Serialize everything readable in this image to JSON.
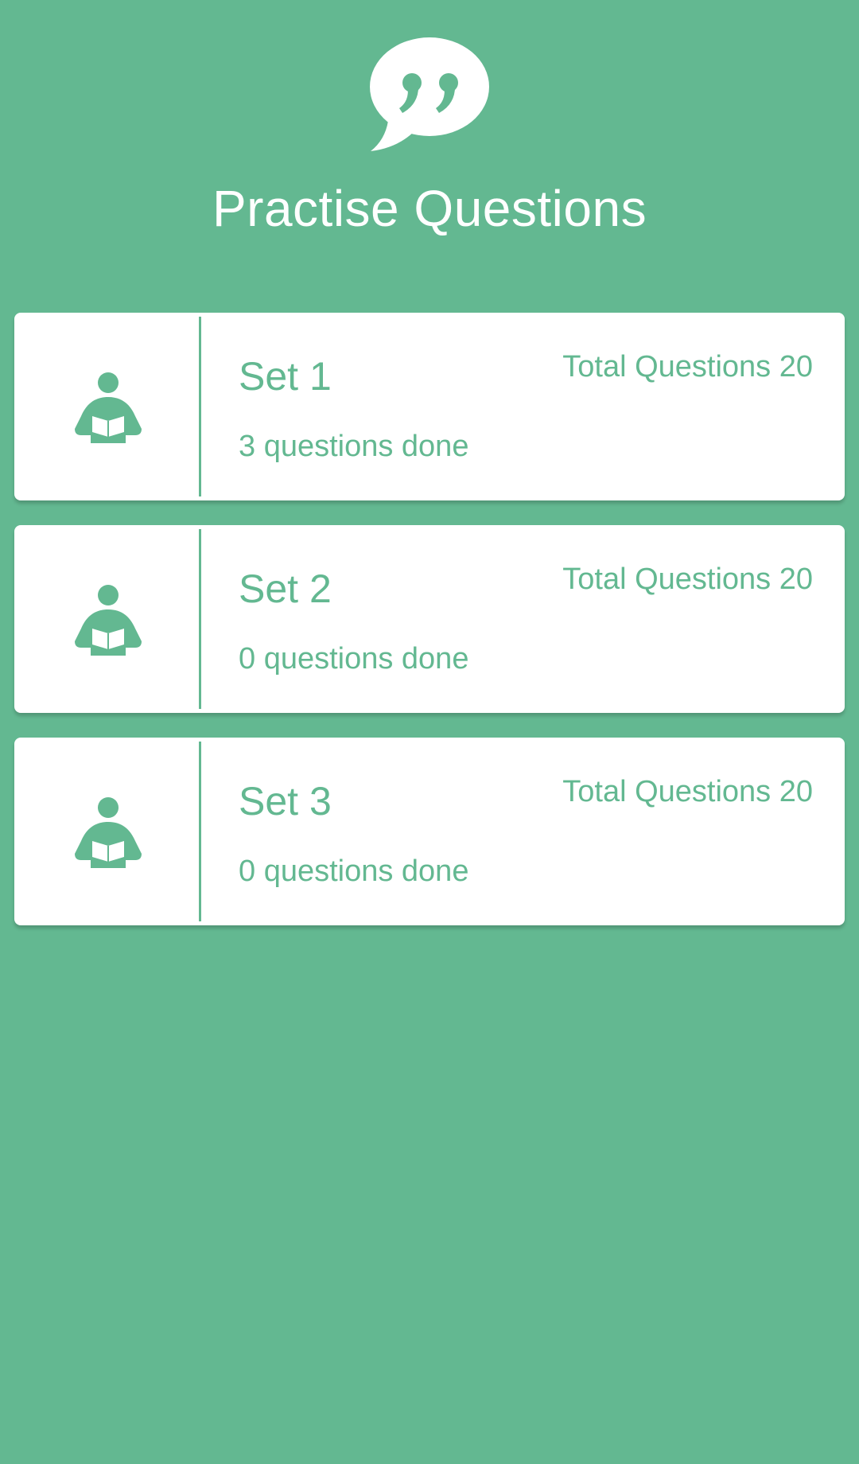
{
  "header": {
    "logo_icon": "quote-speech-bubble-icon",
    "title": "Practise Questions"
  },
  "colors": {
    "background": "#63b891",
    "card": "#ffffff",
    "accent": "#63b891"
  },
  "sets": [
    {
      "icon": "person-reading-book-icon",
      "title": "Set 1",
      "total_label": "Total Questions 20",
      "progress_label": "3 questions done"
    },
    {
      "icon": "person-reading-book-icon",
      "title": "Set 2",
      "total_label": "Total Questions 20",
      "progress_label": "0 questions done"
    },
    {
      "icon": "person-reading-book-icon",
      "title": "Set 3",
      "total_label": "Total Questions 20",
      "progress_label": "0 questions done"
    }
  ]
}
